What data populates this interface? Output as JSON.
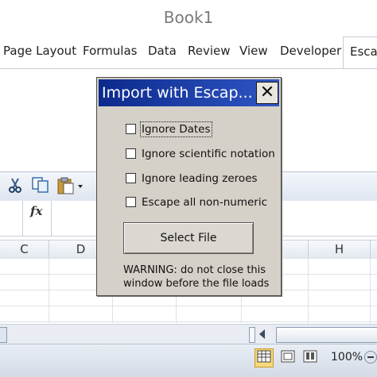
{
  "window": {
    "title": "Book1"
  },
  "ribbon": {
    "tabs": [
      {
        "label": "Page Layout"
      },
      {
        "label": "Formulas"
      },
      {
        "label": "Data"
      },
      {
        "label": "Review"
      },
      {
        "label": "View"
      },
      {
        "label": "Developer"
      },
      {
        "label": "Escap"
      }
    ]
  },
  "toolbar": {
    "icons": [
      "cut-icon",
      "copy-icon",
      "paste-icon"
    ]
  },
  "formula_bar": {
    "fx_label": "fx"
  },
  "columns": [
    "C",
    "D",
    "",
    "",
    "",
    "H",
    ""
  ],
  "status_bar": {
    "zoom": "100%",
    "views": [
      "normal-view-icon",
      "page-layout-view-icon",
      "page-break-preview-icon"
    ]
  },
  "dialog": {
    "title": "Import with Escap...",
    "close_label": "✕",
    "options": [
      {
        "label": "Ignore Dates",
        "checked": false
      },
      {
        "label": "Ignore scientific notation",
        "checked": false
      },
      {
        "label": "Ignore leading zeroes",
        "checked": false
      },
      {
        "label": "Escape all non-numeric",
        "checked": false
      }
    ],
    "button_label": "Select File",
    "warning": "WARNING: do not close this window before the file loads"
  }
}
